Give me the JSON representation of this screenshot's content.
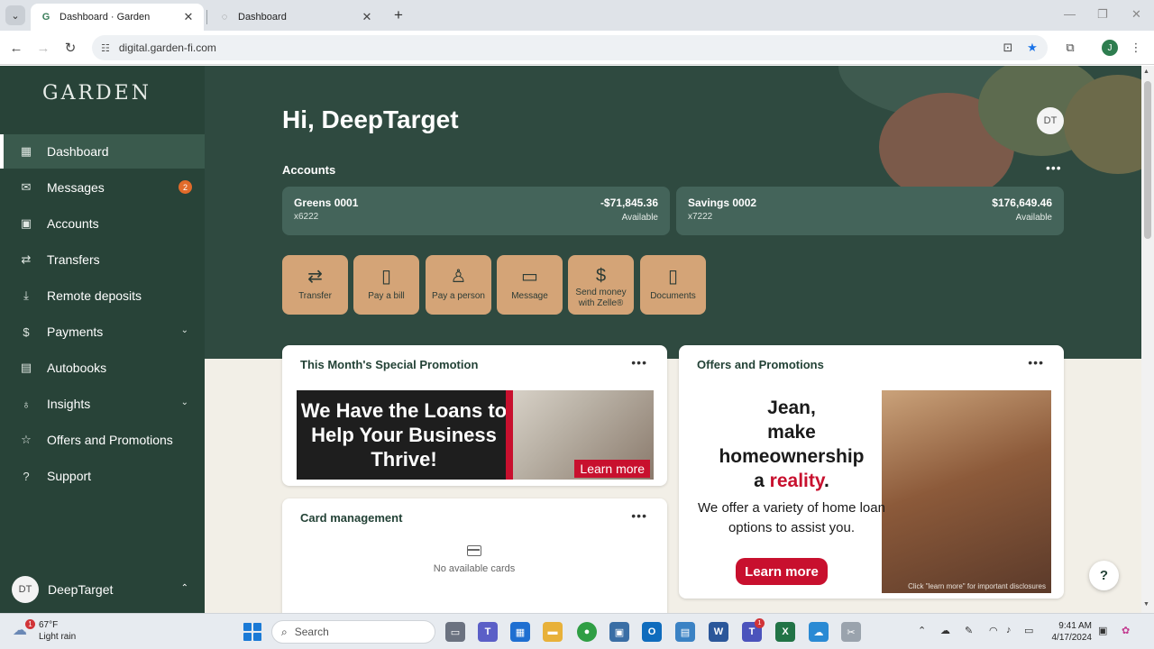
{
  "browser": {
    "tabs": [
      {
        "title": "Dashboard · Garden",
        "active": true
      },
      {
        "title": "Dashboard",
        "active": false
      }
    ],
    "url": "digital.garden-fi.com",
    "profile_initial": "J"
  },
  "sidebar": {
    "logo": "GARDEN",
    "items": [
      {
        "label": "Dashboard",
        "icon": "dashboard-icon",
        "active": true
      },
      {
        "label": "Messages",
        "icon": "mail-icon",
        "badge": "2"
      },
      {
        "label": "Accounts",
        "icon": "accounts-icon"
      },
      {
        "label": "Transfers",
        "icon": "transfer-icon"
      },
      {
        "label": "Remote deposits",
        "icon": "download-icon"
      },
      {
        "label": "Payments",
        "icon": "dollar-icon",
        "expandable": true
      },
      {
        "label": "Autobooks",
        "icon": "book-icon"
      },
      {
        "label": "Insights",
        "icon": "bulb-icon",
        "expandable": true
      },
      {
        "label": "Offers and Promotions",
        "icon": "star-icon"
      },
      {
        "label": "Support",
        "icon": "help-icon"
      }
    ],
    "user": {
      "initials": "DT",
      "name": "DeepTarget"
    }
  },
  "main": {
    "greeting": "Hi, DeepTarget",
    "avatar_initials": "DT",
    "accounts_heading": "Accounts",
    "accounts": [
      {
        "name": "Greens 0001",
        "number": "x6222",
        "amount": "-$71,845.36",
        "label": "Available"
      },
      {
        "name": "Savings 0002",
        "number": "x7222",
        "amount": "$176,649.46",
        "label": "Available"
      }
    ],
    "quick_actions": [
      {
        "label": "Transfer",
        "icon": "transfer-icon"
      },
      {
        "label": "Pay a bill",
        "icon": "bill-icon"
      },
      {
        "label": "Pay a person",
        "icon": "person-icon"
      },
      {
        "label": "Message",
        "icon": "message-icon"
      },
      {
        "label": "Send money\nwith Zelle®",
        "icon": "dollar-circle-icon"
      },
      {
        "label": "Documents",
        "icon": "document-icon"
      }
    ],
    "special_promo": {
      "title": "This Month's Special Promotion",
      "headline": "We Have the Loans to Help Your Business Thrive!",
      "cta": "Learn more"
    },
    "card_management": {
      "title": "Card management",
      "empty_text": "No available cards"
    },
    "offers": {
      "title": "Offers and Promotions",
      "line1": "Jean,",
      "line2": "make",
      "line3": "homeownership",
      "line4_pre": "a ",
      "line4_red": "reality",
      "line4_post": ".",
      "sub": "We offer a variety of home loan options to assist you.",
      "cta": "Learn more",
      "disclosure": "Click \"learn more\" for important disclosures"
    },
    "help_label": "?"
  },
  "taskbar": {
    "weather_temp": "67°F",
    "weather_desc": "Light rain",
    "weather_badge": "1",
    "search_placeholder": "Search",
    "teams_badge": "1",
    "time": "9:41 AM",
    "date": "4/17/2024"
  },
  "colors": {
    "sidebar_bg": "#284338",
    "hero_bg": "#2f4a40",
    "quick_action_bg": "#d4a477",
    "promo_red": "#c8102e",
    "badge_orange": "#e26b2a"
  }
}
